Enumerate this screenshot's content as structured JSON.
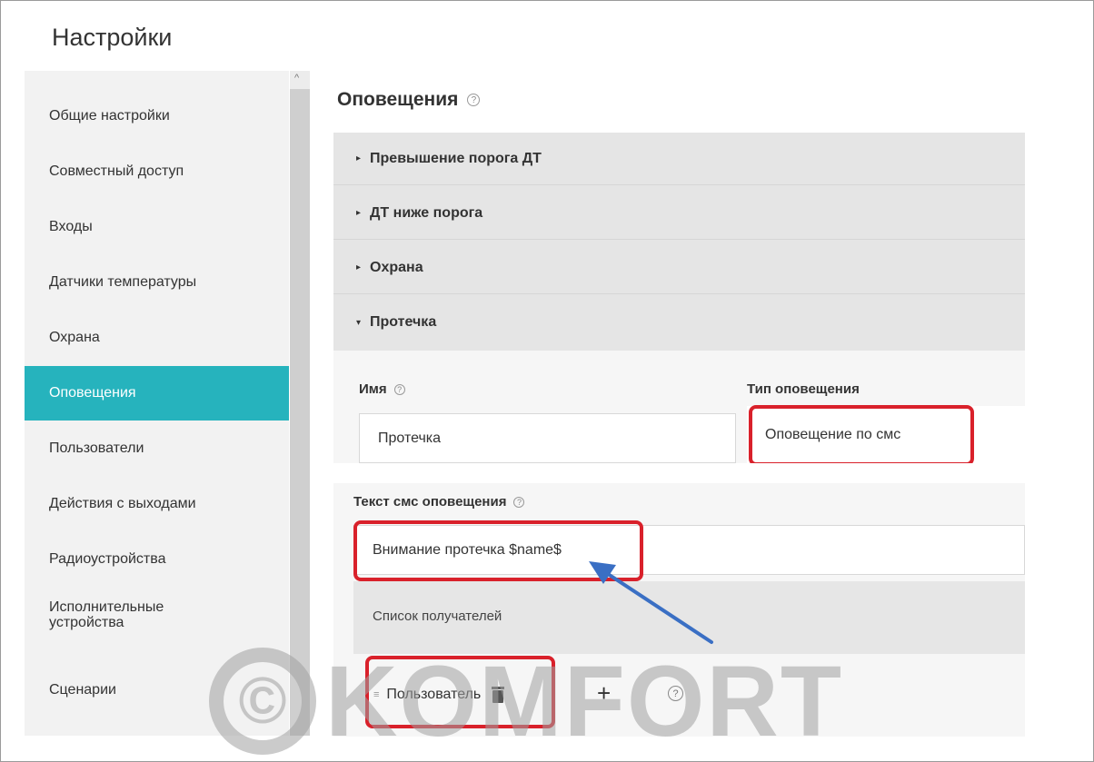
{
  "page": {
    "title": "Настройки"
  },
  "sidebar": {
    "items": [
      {
        "label": "Общие настройки"
      },
      {
        "label": "Совместный доступ"
      },
      {
        "label": "Входы"
      },
      {
        "label": "Датчики температуры"
      },
      {
        "label": "Охрана"
      },
      {
        "label": "Оповещения"
      },
      {
        "label": "Пользователи"
      },
      {
        "label": "Действия с выходами"
      },
      {
        "label": "Радиоустройства"
      },
      {
        "label": "Исполнительные устройства",
        "line1": "Исполнительные",
        "line2": "устройства"
      },
      {
        "label": "Сценарии"
      }
    ],
    "active_index": 5
  },
  "main": {
    "section_title": "Оповещения",
    "help_glyph": "?",
    "accordion": [
      {
        "label": "Превышение порога ДТ",
        "arrow": "▸",
        "expanded": false
      },
      {
        "label": "ДТ ниже порога",
        "arrow": "▸",
        "expanded": false
      },
      {
        "label": "Охрана",
        "arrow": "▸",
        "expanded": false
      },
      {
        "label": "Протечка",
        "arrow": "▾",
        "expanded": true
      }
    ],
    "form": {
      "name_label": "Имя",
      "name_value": "Протечка",
      "type_label": "Тип оповещения",
      "type_value": "Оповещение по смс",
      "sms_label": "Текст смс оповещения",
      "sms_value": "Внимание протечка $name$",
      "recipients_label": "Список получателей",
      "recipient": {
        "label": "Пользователь",
        "drag_glyph": "≡"
      },
      "add_glyph": "+"
    }
  },
  "watermark": {
    "text": "KOMFORT",
    "symbol": "©"
  },
  "colors": {
    "accent": "#26b3bd",
    "highlight": "#d9212b",
    "annotation_arrow": "#3a6fc4",
    "sidebar_bg": "#f2f2f2",
    "accordion_bg": "#e5e5e5"
  }
}
